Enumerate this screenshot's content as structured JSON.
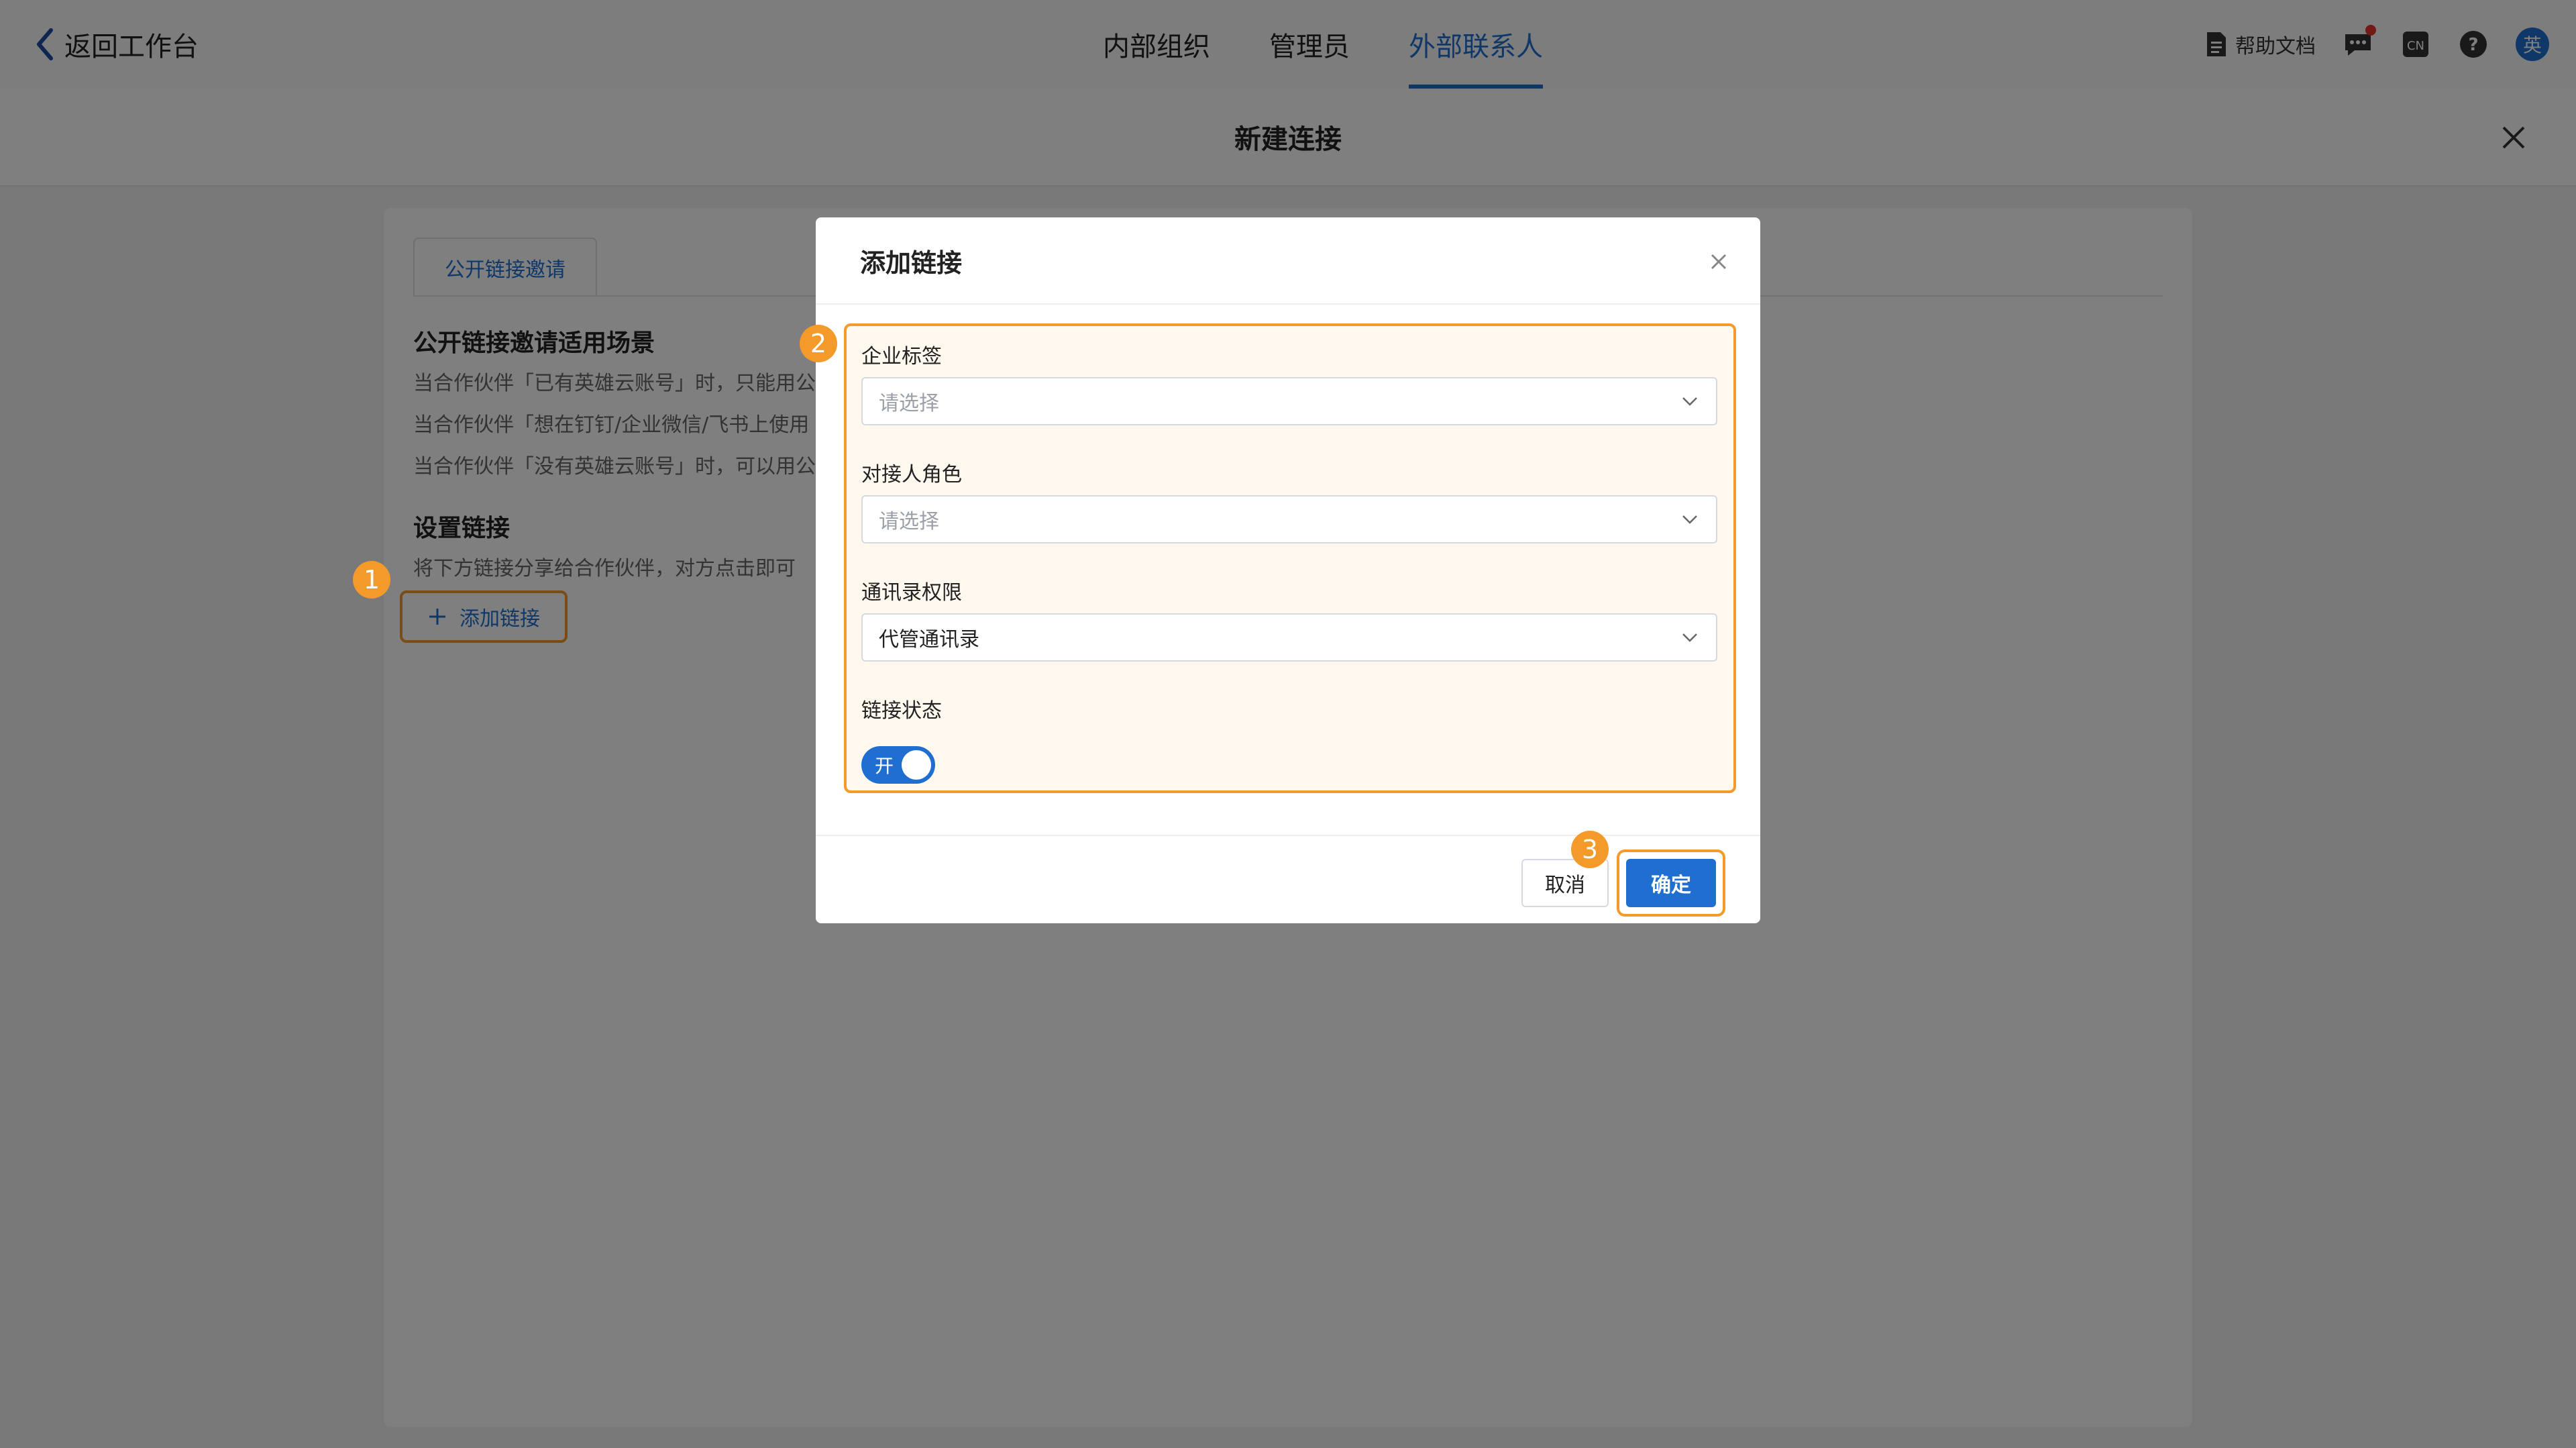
{
  "topbar": {
    "back_label": "返回工作台",
    "tabs": [
      {
        "label": "内部组织",
        "active": false
      },
      {
        "label": "管理员",
        "active": false
      },
      {
        "label": "外部联系人",
        "active": true
      }
    ],
    "help_label": "帮助文档",
    "avatar_text": "英",
    "accent_color": "#1f6fd1"
  },
  "page": {
    "title": "新建连接",
    "subtab_label": "公开链接邀请",
    "scene_heading": "公开链接邀请适用场景",
    "scene_lines": [
      "当合作伙伴「已有英雄云账号」时，只能用公",
      "当合作伙伴「想在钉钉/企业微信/飞书上使用",
      "当合作伙伴「没有英雄云账号」时，可以用公"
    ],
    "setup_heading": "设置链接",
    "setup_desc": "将下方链接分享给合作伙伴，对方点击即可",
    "add_link_label": "添加链接"
  },
  "modal": {
    "title": "添加链接",
    "fields": [
      {
        "label": "企业标签",
        "placeholder": "请选择",
        "value": ""
      },
      {
        "label": "对接人角色",
        "placeholder": "请选择",
        "value": ""
      },
      {
        "label": "通讯录权限",
        "placeholder": "",
        "value": "代管通讯录"
      }
    ],
    "status_label": "链接状态",
    "toggle_text": "开",
    "toggle_on": true,
    "cancel_label": "取消",
    "ok_label": "确定"
  },
  "annotations": {
    "step1": "1",
    "step2": "2",
    "step3": "3",
    "highlight_color": "#f39a2b"
  }
}
